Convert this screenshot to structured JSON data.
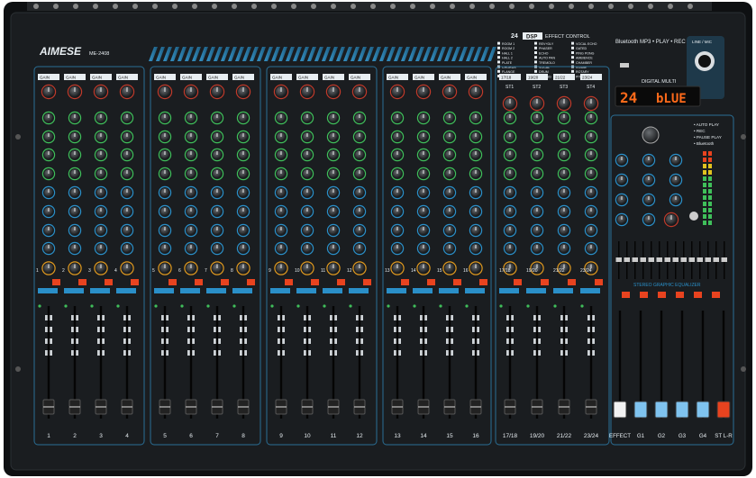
{
  "brand": {
    "logo_text": "AIMESE",
    "model": "ME-2408"
  },
  "effects": {
    "header_count": "24",
    "header_badge": "DSP",
    "header_title": "EFFECT CONTROL",
    "presets": [
      "ROOM 1",
      "ROOM 2",
      "HALL 1",
      "HALL 2",
      "PLATE",
      "CHORUS",
      "FLANGE",
      "DELAY",
      "REV+DLY",
      "PHASER",
      "ECHO",
      "AUTO PAN",
      "TREMOLO",
      "VOCAL",
      "DRUM",
      "SPRING",
      "VOCAL ECHO",
      "GATED",
      "PING PONG",
      "AMBIENCE",
      "CHAMBER",
      "STAGE",
      "ROTARY",
      "PITCH"
    ]
  },
  "media": {
    "header": "Bluetooth  MP3 • PLAY • REC",
    "display_label": "DIGITAL MULTI",
    "display_number": "24",
    "display_text": "bLUE",
    "options": [
      "• AUTO PLAY",
      "• REC",
      "• PAUSE PLAY",
      "• Bluetooth"
    ],
    "mic_label": "LINE / MIC"
  },
  "mono_channels": [
    "1",
    "2",
    "3",
    "4",
    "5",
    "6",
    "7",
    "8",
    "9",
    "10",
    "11",
    "12",
    "13",
    "14",
    "15",
    "16"
  ],
  "stereo_channels": [
    {
      "top": "17/18",
      "short": "ST1",
      "bottom": "17/18"
    },
    {
      "top": "19/20",
      "short": "ST2",
      "bottom": "19/20"
    },
    {
      "top": "21/22",
      "short": "ST3",
      "bottom": "21/22"
    },
    {
      "top": "23/24",
      "short": "ST4",
      "bottom": "23/24"
    }
  ],
  "master_faders": [
    "EFFECT",
    "G1",
    "G2",
    "G3",
    "G4",
    "ST L-R"
  ],
  "eq_label": "STEREO GRAPHIC EQUALIZER",
  "knob_label": "GAIN",
  "colors": {
    "panel": "#16191c",
    "accent": "#2a8fc8",
    "led": "#e8431f",
    "eq_green": "#3fbf5a"
  }
}
